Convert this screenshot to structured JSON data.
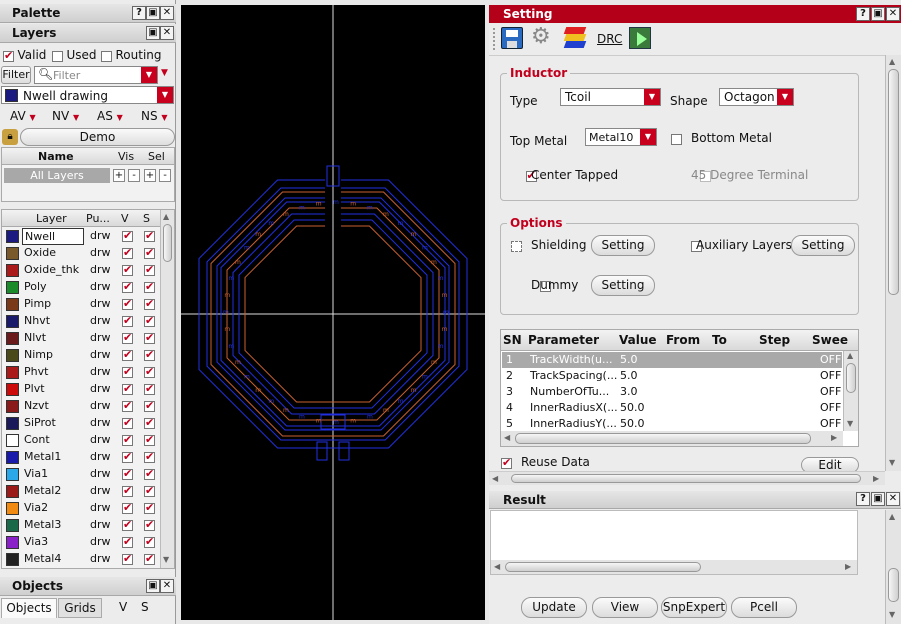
{
  "palette": {
    "title": "Palette",
    "layers_title": "Layers",
    "filters": [
      {
        "label": "Valid",
        "checked": true
      },
      {
        "label": "Used",
        "checked": false
      },
      {
        "label": "Routing",
        "checked": false
      }
    ],
    "filter_button": "Filter",
    "filter_placeholder": "Filter",
    "current_layer": "Nwell drawing",
    "visibility_groups": [
      "AV",
      "NV",
      "AS",
      "NS"
    ],
    "set_name": "Demo",
    "sets_header": {
      "name": "Name",
      "vis": "Vis",
      "sel": "Sel"
    },
    "all_layers": "All Layers",
    "plusminus": [
      "+",
      "-",
      "+",
      "-"
    ],
    "layer_header": {
      "layer": "Layer",
      "purpose": "Pu...",
      "v": "V",
      "s": "S"
    },
    "layers": [
      {
        "name": "Nwell",
        "purpose": "drw",
        "color": "#1a1a80"
      },
      {
        "name": "Oxide",
        "purpose": "drw",
        "color": "#7a5a2a"
      },
      {
        "name": "Oxide_thk",
        "purpose": "drw",
        "color": "#aa1a1a"
      },
      {
        "name": "Poly",
        "purpose": "drw",
        "color": "#1a8a2a"
      },
      {
        "name": "Pimp",
        "purpose": "drw",
        "color": "#7a3a1a"
      },
      {
        "name": "Nhvt",
        "purpose": "drw",
        "color": "#1a1a6a"
      },
      {
        "name": "Nlvt",
        "purpose": "drw",
        "color": "#6a1a1a"
      },
      {
        "name": "Nimp",
        "purpose": "drw",
        "color": "#4a4a1a"
      },
      {
        "name": "Phvt",
        "purpose": "drw",
        "color": "#aa1a1a"
      },
      {
        "name": "Plvt",
        "purpose": "drw",
        "color": "#cc0a0a"
      },
      {
        "name": "Nzvt",
        "purpose": "drw",
        "color": "#8a1a1a"
      },
      {
        "name": "SiProt",
        "purpose": "drw",
        "color": "#1a1a5a"
      },
      {
        "name": "Cont",
        "purpose": "drw",
        "color": "#ffffff"
      },
      {
        "name": "Metal1",
        "purpose": "drw",
        "color": "#1a1aaa"
      },
      {
        "name": "Via1",
        "purpose": "drw",
        "color": "#2aa8e8"
      },
      {
        "name": "Metal2",
        "purpose": "drw",
        "color": "#9a1a1a"
      },
      {
        "name": "Via2",
        "purpose": "drw",
        "color": "#f08a10"
      },
      {
        "name": "Metal3",
        "purpose": "drw",
        "color": "#1a6a4a"
      },
      {
        "name": "Via3",
        "purpose": "drw",
        "color": "#8a20c8"
      },
      {
        "name": "Metal4",
        "purpose": "drw",
        "color": "#222222"
      }
    ],
    "objects_title": "Objects",
    "objects_tabs": [
      "Objects",
      "Grids"
    ],
    "objects_cols": [
      "V",
      "S"
    ]
  },
  "setting": {
    "title": "Setting",
    "toolbar": {
      "drc_label": "DRC"
    },
    "inductor": {
      "group_title": "Inductor",
      "type_label": "Type",
      "type_value": "Tcoil",
      "shape_label": "Shape",
      "shape_value": "Octagon",
      "top_metal_label": "Top Metal",
      "top_metal_value": "Metal10",
      "bottom_metal_label": "Bottom Metal",
      "bottom_metal_checked": false,
      "center_tapped_label": "Center Tapped",
      "center_tapped_checked": true,
      "deg45_label": "45 Degree Terminal",
      "deg45_checked": false
    },
    "options": {
      "group_title": "Options",
      "shielding_label": "Shielding",
      "aux_layers_label": "Auxiliary Layers",
      "dummy_label": "Dummy",
      "setting_button": "Setting"
    },
    "table": {
      "headers": [
        "SN",
        "Parameter",
        "Value",
        "From",
        "To",
        "Step",
        "Swee"
      ],
      "rows": [
        {
          "sn": "1",
          "param": "TrackWidth(u...",
          "value": "5.0",
          "sweep": "OFF"
        },
        {
          "sn": "2",
          "param": "TrackSpacing(...",
          "value": "5.0",
          "sweep": "OFF"
        },
        {
          "sn": "3",
          "param": "NumberOfTu...",
          "value": "3.0",
          "sweep": "OFF"
        },
        {
          "sn": "4",
          "param": "InnerRadiusX(...",
          "value": "50.0",
          "sweep": "OFF"
        },
        {
          "sn": "5",
          "param": "InnerRadiusY(...",
          "value": "50.0",
          "sweep": "OFF"
        }
      ]
    },
    "reuse_data_label": "Reuse Data",
    "reuse_data_checked": true,
    "edit_button": "Edit"
  },
  "result": {
    "title": "Result"
  },
  "bottom_buttons": [
    "Update",
    "View",
    "SnpExpert",
    "Pcell"
  ],
  "colors": {
    "accent": "#b5001a",
    "metal_a": "#2030e0",
    "metal_b": "#c86030"
  }
}
